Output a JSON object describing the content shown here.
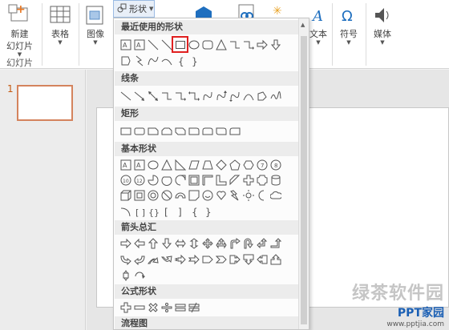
{
  "ribbon": {
    "new_slide": "新建\n幻灯片",
    "new_slide_line1": "新建",
    "new_slide_line2": "幻灯片",
    "table": "表格",
    "image": "图像",
    "shapes_button": "形状",
    "text": "文本",
    "symbol": "符号",
    "media": "媒体",
    "group_slides": "幻灯片"
  },
  "slide_pane": {
    "slide_number": "1"
  },
  "shapes_menu": {
    "sections": [
      "最近使用的形状",
      "线条",
      "矩形",
      "基本形状",
      "箭头总汇",
      "公式形状",
      "流程图"
    ]
  },
  "watermark": {
    "line1": "绿茶软件园",
    "line2": "PPT家园",
    "line3": "www.pptjia.com"
  },
  "colors": {
    "accent": "#c55a11",
    "selection": "#e02020",
    "thumb_border": "#d4835d"
  }
}
